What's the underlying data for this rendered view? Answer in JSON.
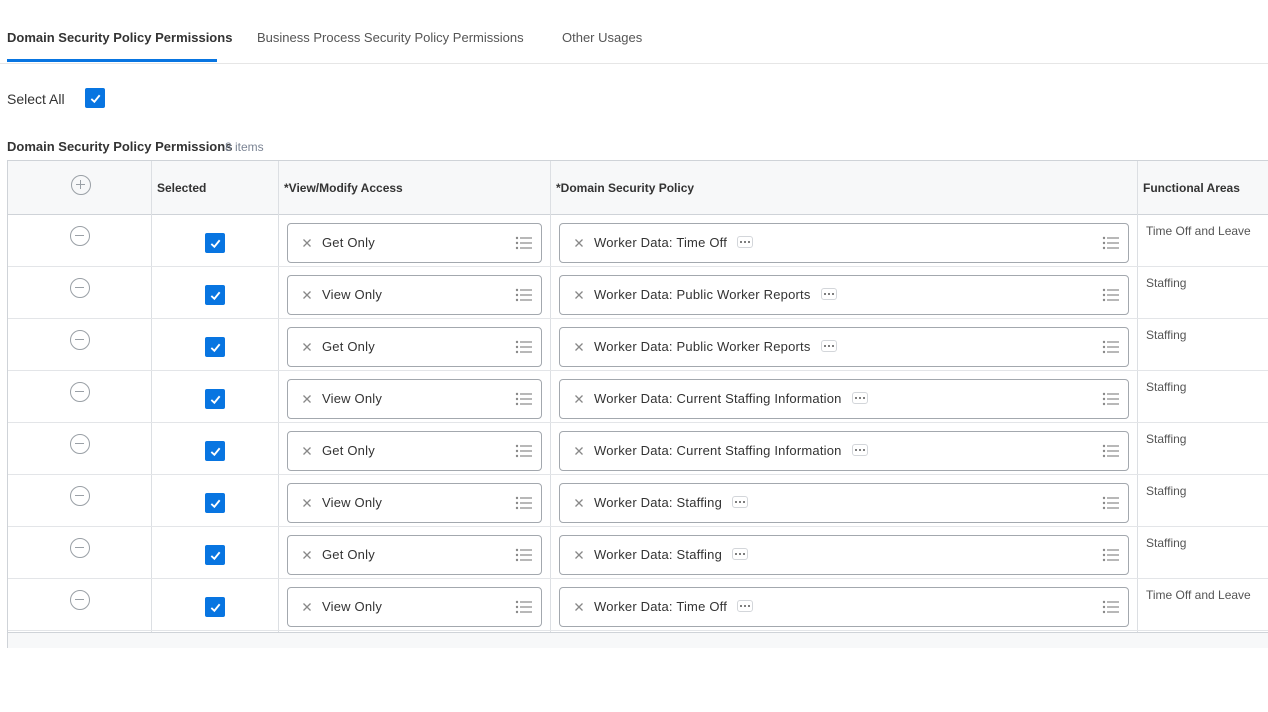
{
  "tabs": [
    {
      "label": "Domain Security Policy Permissions",
      "active": true
    },
    {
      "label": "Business Process Security Policy Permissions",
      "active": false
    },
    {
      "label": "Other Usages",
      "active": false
    }
  ],
  "select_all": {
    "label": "Select All",
    "checked": true
  },
  "grid": {
    "title": "Domain Security Policy Permissions",
    "count": "8 items",
    "columns": [
      "Selected",
      "*View/Modify Access",
      "*Domain Security Policy",
      "Functional Areas"
    ],
    "rows": [
      {
        "selected": true,
        "access": "Get Only",
        "policy": "Worker Data: Time Off",
        "area": "Time Off and Leave"
      },
      {
        "selected": true,
        "access": "View Only",
        "policy": "Worker Data: Public Worker Reports",
        "area": "Staffing"
      },
      {
        "selected": true,
        "access": "Get Only",
        "policy": "Worker Data: Public Worker Reports",
        "area": "Staffing"
      },
      {
        "selected": true,
        "access": "View Only",
        "policy": "Worker Data: Current Staffing Information",
        "area": "Staffing"
      },
      {
        "selected": true,
        "access": "Get Only",
        "policy": "Worker Data: Current Staffing Information",
        "area": "Staffing"
      },
      {
        "selected": true,
        "access": "View Only",
        "policy": "Worker Data: Staffing",
        "area": "Staffing"
      },
      {
        "selected": true,
        "access": "Get Only",
        "policy": "Worker Data: Staffing",
        "area": "Staffing"
      },
      {
        "selected": true,
        "access": "View Only",
        "policy": "Worker Data: Time Off",
        "area": "Time Off and Leave"
      }
    ]
  },
  "colors": {
    "accent": "#0875e1",
    "border": "#cfd3d8",
    "header_bg": "#f7f8f9"
  },
  "icons": {
    "add": "plus-circle-icon",
    "remove": "minus-circle-icon",
    "clear": "x-icon",
    "prompt": "list-icon",
    "related": "ellipsis-icon",
    "check": "checkmark-icon"
  }
}
